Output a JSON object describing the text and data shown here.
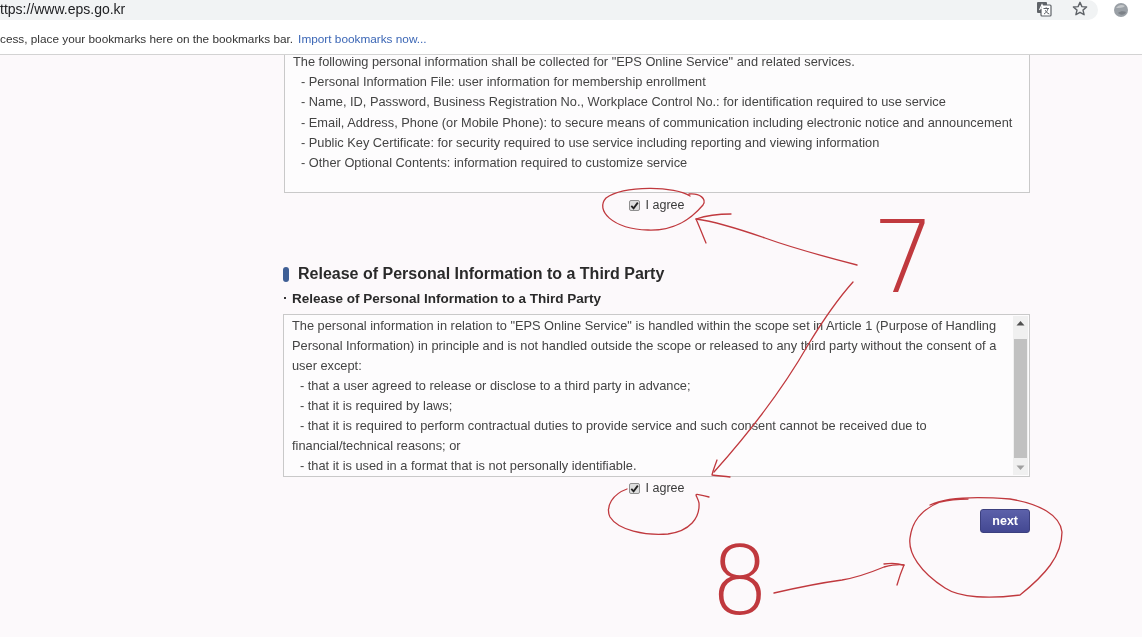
{
  "browser": {
    "address": "ttps://www.eps.go.kr",
    "bookmarks_bar": {
      "hint": "cess, place your bookmarks here on the bookmarks bar.",
      "link": "Import bookmarks now..."
    }
  },
  "sections": [
    {
      "content": [
        {
          "kind": "paragraph",
          "text": "The following personal information shall be collected for \"EPS Online Service\" and related services."
        },
        {
          "kind": "item",
          "text": "- Personal Information File: user information for membership enrollment"
        },
        {
          "kind": "item",
          "text": "- Name, ID, Password, Business Registration No., Workplace Control No.: for identification required to use service"
        },
        {
          "kind": "item",
          "text": "- Email, Address, Phone (or Mobile Phone): to secure means of communication including electronic notice and announcement"
        },
        {
          "kind": "item",
          "text": "- Public Key Certificate: for security required to use service including reporting and viewing information"
        },
        {
          "kind": "item",
          "text": "- Other Optional Contents: information required to customize service"
        }
      ],
      "agree": {
        "label": "I agree",
        "checked": true
      }
    },
    {
      "title": "Release of Personal Information to a Third Party",
      "subtitle": "Release of Personal Information to a Third Party",
      "scrollbar": true,
      "content": [
        {
          "kind": "paragraph",
          "text": "The personal information in relation to \"EPS Online Service\" is handled within the scope set in Article 1 (Purpose of Handling Personal Information) in principle and is not handled outside the scope or released to any third party without the consent of a user except:"
        },
        {
          "kind": "item",
          "text": "- that a user agreed to release or disclose to a third party in advance;"
        },
        {
          "kind": "item",
          "text": "- that it is required by laws;"
        },
        {
          "kind": "item",
          "text": "- that it is required to perform contractual duties to provide service and such consent cannot be received due to financial/technical reasons; or"
        },
        {
          "kind": "item",
          "text": "- that it is used in a format that is not personally identifiable."
        }
      ],
      "agree": {
        "label": "I agree",
        "checked": true
      }
    }
  ],
  "next_button": "next",
  "annotations": {
    "step_numbers": [
      "7",
      "8"
    ]
  }
}
